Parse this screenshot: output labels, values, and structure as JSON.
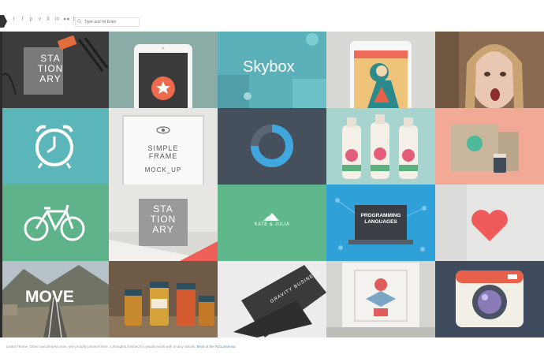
{
  "header": {
    "social_icons": [
      "twitter-icon",
      "facebook-icon",
      "pinterest-icon",
      "vimeo-icon",
      "vk-icon",
      "linkedin-icon",
      "flickr-icon",
      "behance-icon"
    ],
    "social_glyphs": [
      "t",
      "f",
      "p",
      "v",
      "k",
      "in",
      "●●",
      "b"
    ],
    "search_placeholder": "Type and hit Enter"
  },
  "tiles": {
    "stationary1": "STA TION ARY",
    "skybox": "Skybox",
    "simple_frame": "SIMPLE FRAME",
    "simple_frame_sub": "MOCK_UP",
    "stationary2": "STA TION ARY",
    "kate_julia": "KATE & JULIA",
    "programming": "PROGRAMMING LANGUAGES",
    "move": "MOVE",
    "gravity": "GRAVITY BUSINESS"
  },
  "footer": {
    "text": "Listed Theme. Other and all best ones, see proudly present here. A thoughts finished for visual minds with a sexy details.",
    "link": "Most of the NGLantenna"
  },
  "colors": {
    "teal": "#5bb4b7",
    "green": "#5fb38a",
    "dark": "#47505c",
    "salmon": "#f2a99b",
    "coral": "#f36d60"
  }
}
